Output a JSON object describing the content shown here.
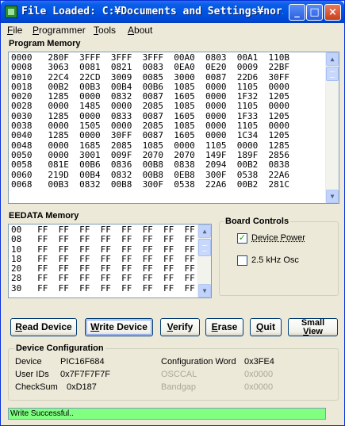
{
  "window": {
    "title": "File Loaded: C:¥Documents and Settings¥noriaki",
    "controls": {
      "minimize": "_",
      "maximize": "□",
      "close": "×"
    }
  },
  "menu": [
    {
      "label": "File",
      "u": "F",
      "rest": "ile"
    },
    {
      "label": "Programmer",
      "u": "P",
      "rest": "rogrammer"
    },
    {
      "label": "Tools",
      "u": "T",
      "rest": "ools"
    },
    {
      "label": "About",
      "u": "A",
      "rest": "bout"
    }
  ],
  "program_memory": {
    "label": "Program Memory",
    "rows": [
      "0000   280F  3FFF  3FFF  3FFF  00A0  0803  00A1  110B",
      "0008   3063  0081  0821  0083  0EA0  0E20  0009  22BF",
      "0010   22C4  22CD  3009  0085  3000  0087  22D6  30FF",
      "0018   00B2  00B3  00B4  00B6  1085  0000  1105  0000",
      "0020   1285  0000  0832  0087  1605  0000  1F32  1205",
      "0028   0000  1485  0000  2085  1085  0000  1105  0000",
      "0030   1285  0000  0833  0087  1605  0000  1F33  1205",
      "0038   0000  1505  0000  2085  1085  0000  1105  0000",
      "0040   1285  0000  30FF  0087  1605  0000  1C34  1205",
      "0048   0000  1685  2085  1085  0000  1105  0000  1285",
      "0050   0000  3001  009F  2070  2070  149F  189F  2856",
      "0058   081E  00B6  0836  00B8  0838  2094  00B2  0838",
      "0060   219D  00B4  0832  00B8  0EB8  300F  0538  22A6",
      "0068   00B3  0832  00B8  300F  0538  22A6  00B2  281C"
    ]
  },
  "eedata_memory": {
    "label": "EEDATA Memory",
    "rows": [
      "00   FF  FF  FF  FF  FF  FF  FF  FF",
      "08   FF  FF  FF  FF  FF  FF  FF  FF",
      "10   FF  FF  FF  FF  FF  FF  FF  FF",
      "18   FF  FF  FF  FF  FF  FF  FF  FF",
      "20   FF  FF  FF  FF  FF  FF  FF  FF",
      "28   FF  FF  FF  FF  FF  FF  FF  FF",
      "30   FF  FF  FF  FF  FF  FF  FF  FF"
    ]
  },
  "board_controls": {
    "label": "Board Controls",
    "device_power": {
      "label": "Device Power",
      "checked": true,
      "mark": "✓"
    },
    "osc": {
      "label": "2.5 kHz Osc",
      "checked": false
    }
  },
  "buttons": {
    "read": {
      "u": "R",
      "rest": "ead Device"
    },
    "write": {
      "u": "W",
      "rest": "rite Device"
    },
    "verify": {
      "u": "V",
      "rest": "erify"
    },
    "erase": {
      "u": "E",
      "rest": "rase"
    },
    "quit": {
      "u": "Q",
      "rest": "uit"
    },
    "small_view": {
      "line1": "Small",
      "u": "V",
      "rest": "iew"
    }
  },
  "device_config": {
    "label": "Device Configuration",
    "device_label": "Device",
    "device_value": "PIC16F684",
    "userids_label": "User IDs",
    "userids_value": "0x7F7F7F7F",
    "checksum_label": "CheckSum",
    "checksum_value": "0xD187",
    "config_word_label": "Configuration Word",
    "config_word_value": "0x3FE4",
    "osccal_label": "OSCCAL",
    "osccal_value": "0x0000",
    "bandgap_label": "Bandgap",
    "bandgap_value": "0x0000"
  },
  "status": {
    "text": "Write Successful..",
    "color": "#80ff80"
  }
}
